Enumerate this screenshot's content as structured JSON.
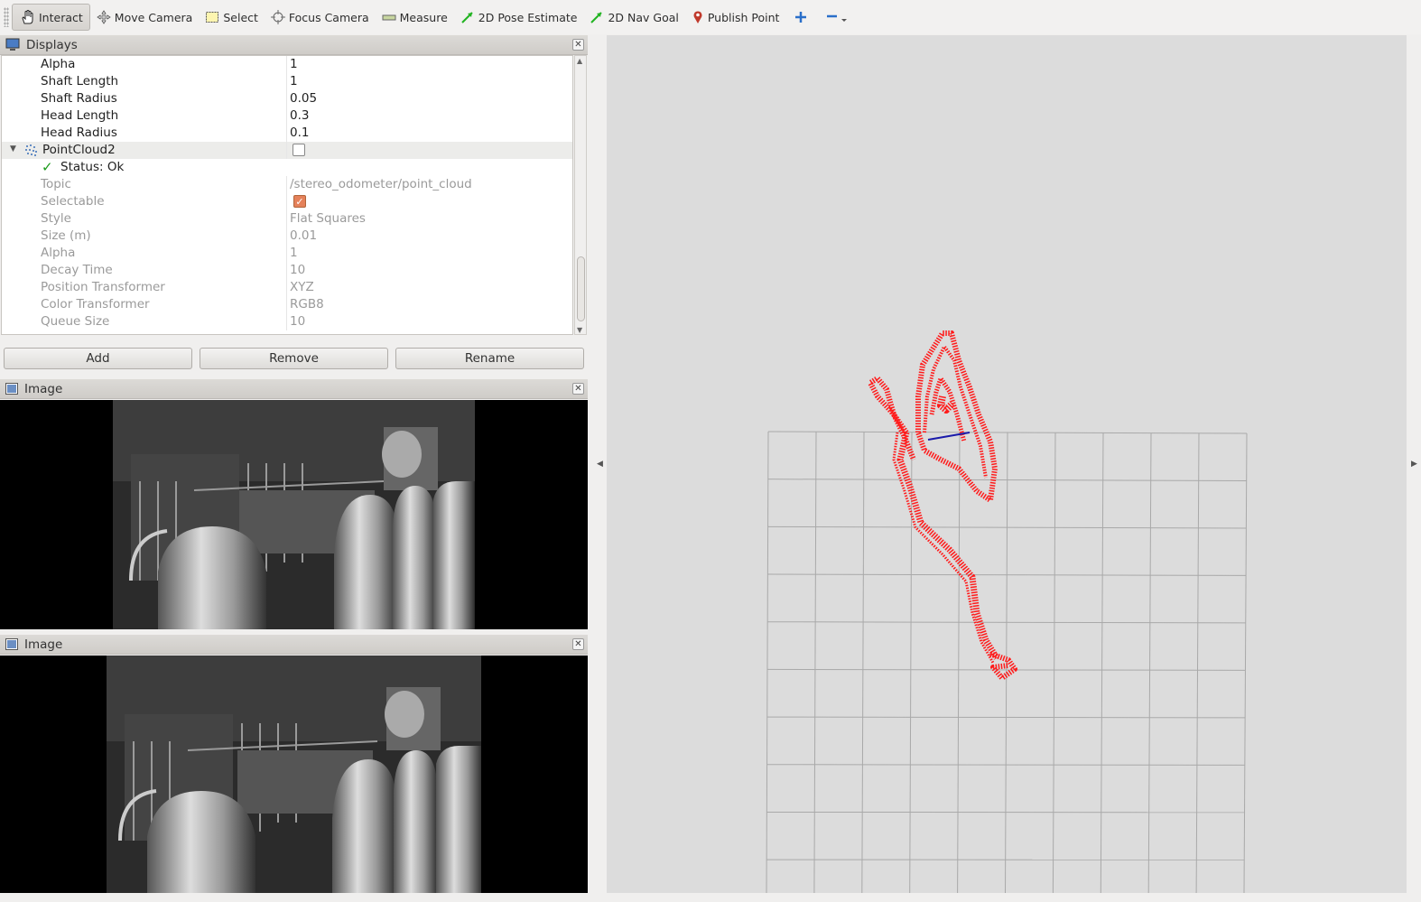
{
  "toolbar": {
    "tools": [
      {
        "label": "Interact",
        "icon": "hand-icon",
        "active": true
      },
      {
        "label": "Move Camera",
        "icon": "move-camera-icon"
      },
      {
        "label": "Select",
        "icon": "select-box-icon"
      },
      {
        "label": "Focus Camera",
        "icon": "crosshair-icon"
      },
      {
        "label": "Measure",
        "icon": "ruler-icon"
      },
      {
        "label": "2D Pose Estimate",
        "icon": "green-arrow-icon"
      },
      {
        "label": "2D Nav Goal",
        "icon": "green-arrow-icon"
      },
      {
        "label": "Publish Point",
        "icon": "map-pin-icon"
      }
    ]
  },
  "displays": {
    "title": "Displays",
    "rows": [
      {
        "key": "Alpha",
        "value": "1",
        "dim": false
      },
      {
        "key": "Shaft Length",
        "value": "1",
        "dim": false
      },
      {
        "key": "Shaft Radius",
        "value": "0.05",
        "dim": false
      },
      {
        "key": "Head Length",
        "value": "0.3",
        "dim": false
      },
      {
        "key": "Head Radius",
        "value": "0.1",
        "dim": false
      }
    ],
    "group": {
      "name": "PointCloud2",
      "checked": false
    },
    "status": "Status: Ok",
    "props": [
      {
        "key": "Topic",
        "value": "/stereo_odometer/point_cloud"
      },
      {
        "key": "Selectable",
        "value": ""
      },
      {
        "key": "Style",
        "value": "Flat Squares"
      },
      {
        "key": "Size (m)",
        "value": "0.01"
      },
      {
        "key": "Alpha",
        "value": "1"
      },
      {
        "key": "Decay Time",
        "value": "10"
      },
      {
        "key": "Position Transformer",
        "value": "XYZ"
      },
      {
        "key": "Color Transformer",
        "value": "RGB8"
      },
      {
        "key": "Queue Size",
        "value": "10"
      }
    ],
    "buttons": {
      "add": "Add",
      "remove": "Remove",
      "rename": "Rename"
    }
  },
  "image_panels": [
    {
      "title": "Image"
    },
    {
      "title": "Image"
    }
  ],
  "colors": {
    "point_cloud": "#ff1a1a",
    "pose_line": "#1a1aaa",
    "grid": "#a8a8a8",
    "view_bg": "#dcdcdc"
  }
}
